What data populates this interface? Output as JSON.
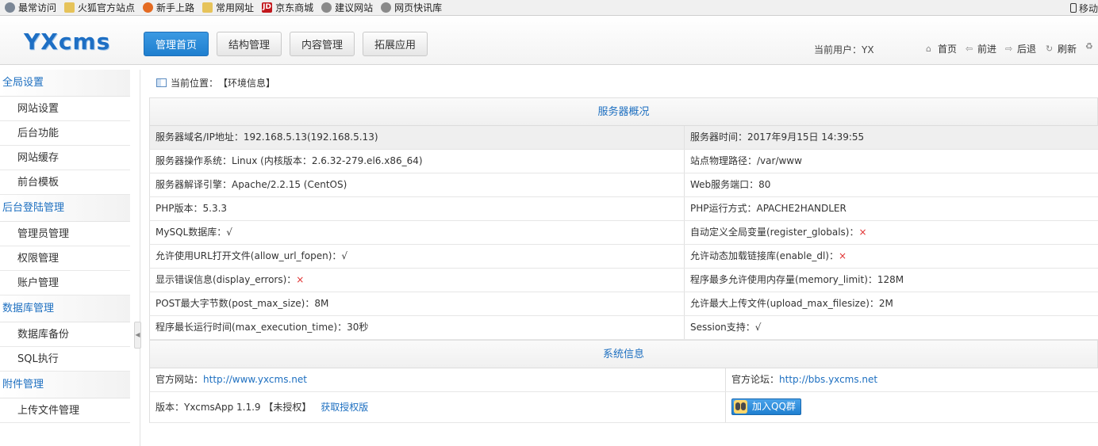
{
  "bookmarks": [
    {
      "icon": "gear-icon",
      "label": "最常访问"
    },
    {
      "icon": "folder-icon",
      "label": "火狐官方站点"
    },
    {
      "icon": "firefox-icon",
      "label": "新手上路"
    },
    {
      "icon": "folder-icon",
      "label": "常用网址"
    },
    {
      "icon": "jd-icon",
      "label": "京东商城"
    },
    {
      "icon": "globe-icon",
      "label": "建议网站"
    },
    {
      "icon": "globe-icon",
      "label": "网页快讯库"
    }
  ],
  "bookmarks_right": "移动",
  "header": {
    "logo": "YXcms",
    "nav": [
      "管理首页",
      "结构管理",
      "内容管理",
      "拓展应用"
    ],
    "current_user": "当前用户：YX",
    "links": {
      "home": "首页",
      "forward": "前进",
      "back": "后退",
      "refresh": "刷新"
    }
  },
  "sidebar": {
    "groups": [
      {
        "title": "全局设置",
        "items": [
          "网站设置",
          "后台功能",
          "网站缓存",
          "前台模板"
        ]
      },
      {
        "title": "后台登陆管理",
        "items": [
          "管理员管理",
          "权限管理",
          "账户管理"
        ]
      },
      {
        "title": "数据库管理",
        "items": [
          "数据库备份",
          "SQL执行"
        ]
      },
      {
        "title": "附件管理",
        "items": [
          "上传文件管理"
        ]
      }
    ]
  },
  "breadcrumb": {
    "label": "当前位置：",
    "location": "【环境信息】"
  },
  "server": {
    "title": "服务器概况",
    "rows": [
      {
        "l_label": "服务器域名/IP地址：",
        "l_value": "192.168.5.13(192.168.5.13)",
        "r_label": "服务器时间：",
        "r_value": "2017年9月15日 14:39:55"
      },
      {
        "l_label": "服务器操作系统：",
        "l_value": "Linux (内核版本：2.6.32-279.el6.x86_64)",
        "r_label": "站点物理路径：",
        "r_value": "/var/www"
      },
      {
        "l_label": "服务器解译引擎：",
        "l_value": "Apache/2.2.15 (CentOS)",
        "r_label": "Web服务端口：",
        "r_value": "80"
      },
      {
        "l_label": "PHP版本：",
        "l_value": "5.3.3",
        "r_label": "PHP运行方式：",
        "r_value": "APACHE2HANDLER"
      },
      {
        "l_label": "MySQL数据库：",
        "l_value": "√",
        "r_label": "自动定义全局变量(register_globals)：",
        "r_value": "×"
      },
      {
        "l_label": "允许使用URL打开文件(allow_url_fopen)：",
        "l_value": "√",
        "r_label": "允许动态加载链接库(enable_dl)：",
        "r_value": "×"
      },
      {
        "l_label": "显示错误信息(display_errors)：",
        "l_value": "×",
        "r_label": "程序最多允许使用内存量(memory_limit)：",
        "r_value": "128M"
      },
      {
        "l_label": "POST最大字节数(post_max_size)：",
        "l_value": "8M",
        "r_label": "允许最大上传文件(upload_max_filesize)：",
        "r_value": "2M"
      },
      {
        "l_label": "程序最长运行时间(max_execution_time)：",
        "l_value": "30秒",
        "r_label": "Session支持：",
        "r_value": "√"
      }
    ]
  },
  "system": {
    "title": "系统信息",
    "official_site_label": "官方网站：",
    "official_site_url": "http://www.yxcms.net",
    "forum_label": "官方论坛：",
    "forum_url": "http://bbs.yxcms.net",
    "version_label": "版本：",
    "version_value": "YxcmsApp 1.1.9 【未授权】",
    "license_link": "获取授权版",
    "qq_button": "加入QQ群"
  }
}
